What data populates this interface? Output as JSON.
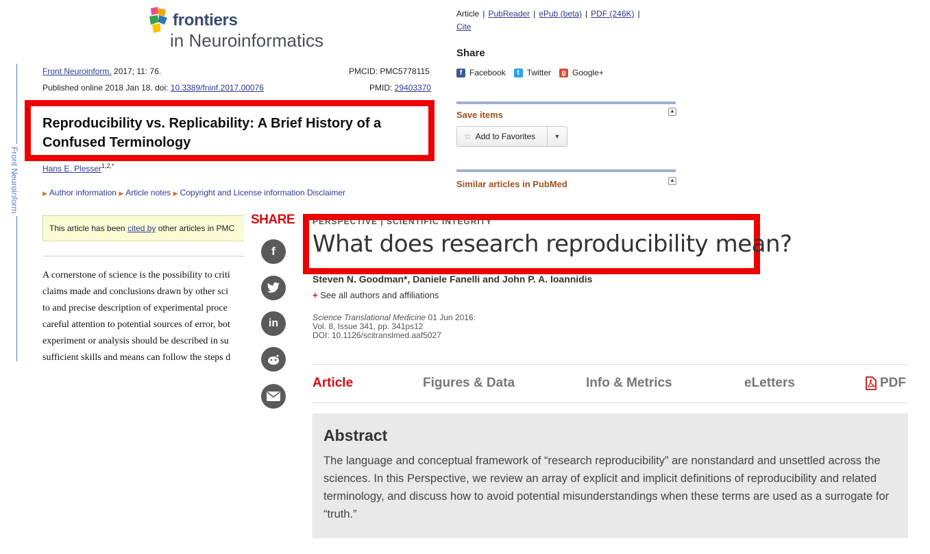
{
  "pmc": {
    "logo": {
      "word1": "frontiers",
      "word2": "in Neuroinformatics"
    },
    "vertical_label": "Front Neuroinform",
    "citation_journal": "Front Neuroinform.",
    "citation_rest": " 2017; 11: 76.",
    "pmcid": "PMCID: PMC5778115",
    "published_prefix": "Published online 2018 Jan 18. doi: ",
    "doi": "10.3389/fninf.2017.00076",
    "pmid_prefix": "PMID: ",
    "pmid": "29403370",
    "title_line1": "Reproducibility vs. Replicability: A Brief History of a",
    "title_line2": "Confused Terminology",
    "author": "Hans E. Plesser",
    "author_sup": "1,2,*",
    "links": [
      "Author information",
      "Article notes",
      "Copyright and "
    ],
    "links_trailing": "License information     Disclaimer",
    "cited_prefix": "This article has been ",
    "cited_link": "cited by",
    "cited_suffix": " other articles in PMC",
    "body_lines": [
      "A cornerstone of science is the possibility to criti",
      "claims made and conclusions drawn by other sci",
      "to and precise description of experimental proce",
      "careful attention to potential sources of error, bot",
      "experiment or analysis should be described in su",
      "sufficient skills and means can follow the steps d"
    ],
    "format_links": {
      "article": "Article",
      "pubreader": "PubReader",
      "epub": "ePub (beta)",
      "pdf": "PDF (246K)",
      "cite": "Cite"
    },
    "share_heading": "Share",
    "share_items": [
      "Facebook",
      "Twitter",
      "Google+"
    ],
    "save_heading": "Save items",
    "favorites_label": "Add to Favorites",
    "similar_heading": "Similar articles in PubMed"
  },
  "science": {
    "share_label": "SHARE",
    "share_icons": [
      "facebook-icon",
      "twitter-icon",
      "linkedin-icon",
      "reddit-icon",
      "email-icon"
    ],
    "category_peek": "PERSPECTIVE  |  SCIENTIFIC INTEGRITY",
    "title": "What does research reproducibility mean?",
    "authors": "Steven N. Goodman*, Daniele Fanelli and John P. A. Ioannidis",
    "see_all": "See all authors and affiliations",
    "journal": "Science Translational Medicine",
    "date": "  01 Jun 2016:",
    "volume": "Vol. 8, Issue 341, pp. 341ps12",
    "doi": "DOI: 10.1126/scitranslmed.aaf5027",
    "tabs": [
      "Article",
      "Figures & Data",
      "Info & Metrics",
      "eLetters"
    ],
    "pdf_tab": "PDF",
    "abstract_heading": "Abstract",
    "abstract_text": "The language and conceptual framework of “research reproducibility” are nonstandard and unsettled across the sciences. In this Perspective, we review an array of explicit and implicit definitions of reproducibility and related terminology, and discuss how to avoid potential misunderstandings when these terms are used as a surrogate for “truth.”"
  },
  "colors": {
    "highlight_red": "#ee0000",
    "science_red": "#d40d12",
    "pmc_link": "#2e3a8c"
  }
}
